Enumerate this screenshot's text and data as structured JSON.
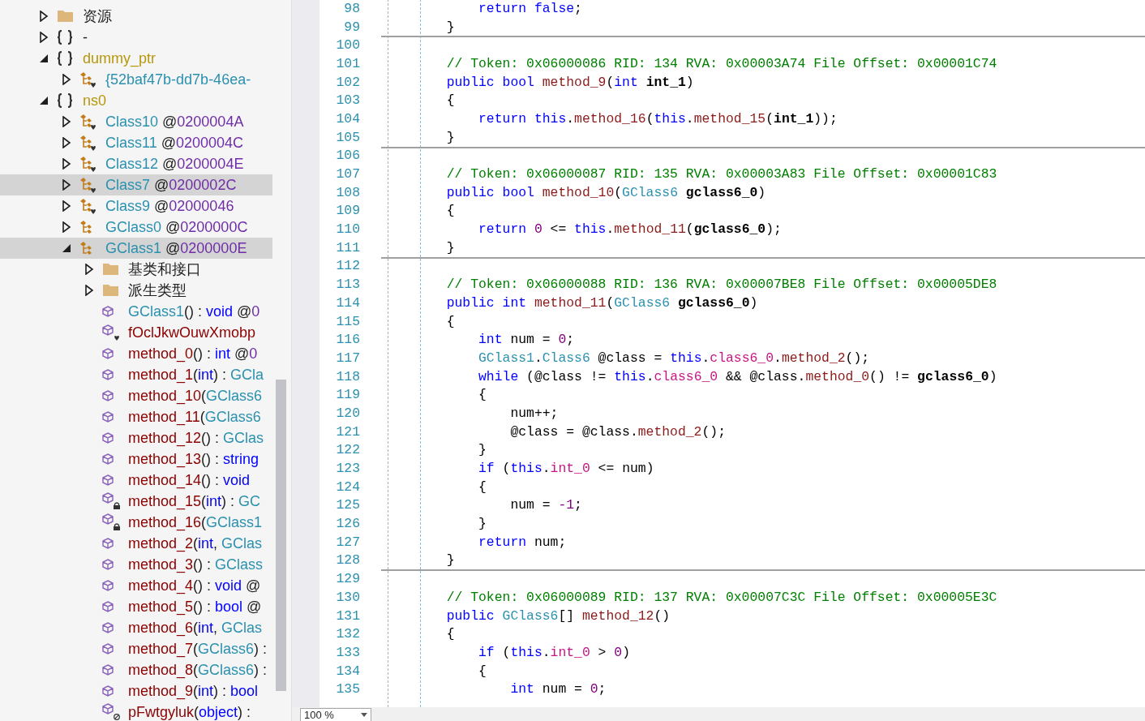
{
  "tree": {
    "items": [
      {
        "kind": "folder",
        "selected": false,
        "expanded": false,
        "label": [
          {
            "t": "资源",
            "kind": "plain"
          }
        ]
      },
      {
        "kind": "namespace",
        "selected": false,
        "expanded": false,
        "label": [
          {
            "t": "-",
            "kind": "plain"
          }
        ]
      },
      {
        "kind": "namespace",
        "selected": false,
        "expanded": true,
        "label": [
          {
            "t": "dummy_ptr",
            "kind": "ns"
          }
        ],
        "children": [
          {
            "kind": "class",
            "selected": false,
            "expanded": false,
            "label": [
              {
                "t": "{52baf47b-dd7b-46ea-",
                "kind": "type"
              }
            ]
          }
        ]
      },
      {
        "kind": "namespace",
        "selected": false,
        "expanded": true,
        "label": [
          {
            "t": "ns0",
            "kind": "ns"
          }
        ],
        "children": [
          {
            "kind": "class",
            "selected": false,
            "expanded": false,
            "label": [
              {
                "t": "Class10",
                "kind": "type"
              },
              {
                "t": " @",
                "kind": "plain"
              },
              {
                "t": "0200004A",
                "kind": "addr"
              }
            ]
          },
          {
            "kind": "class",
            "selected": false,
            "expanded": false,
            "label": [
              {
                "t": "Class11",
                "kind": "type"
              },
              {
                "t": " @",
                "kind": "plain"
              },
              {
                "t": "0200004C",
                "kind": "addr"
              }
            ]
          },
          {
            "kind": "class",
            "selected": false,
            "expanded": false,
            "label": [
              {
                "t": "Class12",
                "kind": "type"
              },
              {
                "t": " @",
                "kind": "plain"
              },
              {
                "t": "0200004E",
                "kind": "addr"
              }
            ]
          },
          {
            "kind": "class",
            "selected": true,
            "expanded": false,
            "label": [
              {
                "t": "Class7",
                "kind": "type"
              },
              {
                "t": " @",
                "kind": "plain"
              },
              {
                "t": "0200002C",
                "kind": "addr"
              }
            ]
          },
          {
            "kind": "class",
            "selected": false,
            "expanded": false,
            "label": [
              {
                "t": "Class9",
                "kind": "type"
              },
              {
                "t": " @",
                "kind": "plain"
              },
              {
                "t": "02000046",
                "kind": "addr"
              }
            ]
          },
          {
            "kind": "gclass",
            "selected": false,
            "expanded": false,
            "label": [
              {
                "t": "GClass0",
                "kind": "type"
              },
              {
                "t": " @",
                "kind": "plain"
              },
              {
                "t": "0200000C",
                "kind": "addr"
              }
            ]
          },
          {
            "kind": "gclass",
            "selected": true,
            "expanded": true,
            "label": [
              {
                "t": "GClass1",
                "kind": "type"
              },
              {
                "t": " @",
                "kind": "plain"
              },
              {
                "t": "0200000E",
                "kind": "addr"
              }
            ],
            "children": [
              {
                "kind": "folder",
                "selected": false,
                "expanded": false,
                "label": [
                  {
                    "t": "基类和接口",
                    "kind": "plain"
                  }
                ]
              },
              {
                "kind": "folder",
                "selected": false,
                "expanded": false,
                "label": [
                  {
                    "t": "派生类型",
                    "kind": "plain"
                  }
                ]
              },
              {
                "kind": "method",
                "selected": false,
                "label": [
                  {
                    "t": "GClass1",
                    "kind": "type"
                  },
                  {
                    "t": "() : ",
                    "kind": "plain"
                  },
                  {
                    "t": "void",
                    "kind": "kw"
                  },
                  {
                    "t": " @",
                    "kind": "plain"
                  },
                  {
                    "t": "0",
                    "kind": "addr"
                  }
                ]
              },
              {
                "kind": "internalmethod",
                "selected": false,
                "label": [
                  {
                    "t": "fOclJkwOuwXmobp",
                    "kind": "method"
                  }
                ]
              },
              {
                "kind": "method",
                "selected": false,
                "label": [
                  {
                    "t": "method_0",
                    "kind": "method"
                  },
                  {
                    "t": "() : ",
                    "kind": "plain"
                  },
                  {
                    "t": "int",
                    "kind": "kw"
                  },
                  {
                    "t": " @",
                    "kind": "plain"
                  },
                  {
                    "t": "0",
                    "kind": "addr"
                  }
                ]
              },
              {
                "kind": "method",
                "selected": false,
                "label": [
                  {
                    "t": "method_1",
                    "kind": "method"
                  },
                  {
                    "t": "(",
                    "kind": "plain"
                  },
                  {
                    "t": "int",
                    "kind": "kw"
                  },
                  {
                    "t": ") : ",
                    "kind": "plain"
                  },
                  {
                    "t": "GCla",
                    "kind": "type"
                  }
                ]
              },
              {
                "kind": "method",
                "selected": false,
                "label": [
                  {
                    "t": "method_10",
                    "kind": "method"
                  },
                  {
                    "t": "(",
                    "kind": "plain"
                  },
                  {
                    "t": "GClass6",
                    "kind": "type"
                  }
                ]
              },
              {
                "kind": "method",
                "selected": false,
                "label": [
                  {
                    "t": "method_11",
                    "kind": "method"
                  },
                  {
                    "t": "(",
                    "kind": "plain"
                  },
                  {
                    "t": "GClass6",
                    "kind": "type"
                  }
                ]
              },
              {
                "kind": "method",
                "selected": false,
                "label": [
                  {
                    "t": "method_12",
                    "kind": "method"
                  },
                  {
                    "t": "() : ",
                    "kind": "plain"
                  },
                  {
                    "t": "GClas",
                    "kind": "type"
                  }
                ]
              },
              {
                "kind": "method",
                "selected": false,
                "label": [
                  {
                    "t": "method_13",
                    "kind": "method"
                  },
                  {
                    "t": "() : ",
                    "kind": "plain"
                  },
                  {
                    "t": "string",
                    "kind": "kw"
                  }
                ]
              },
              {
                "kind": "method",
                "selected": false,
                "label": [
                  {
                    "t": "method_14",
                    "kind": "method"
                  },
                  {
                    "t": "() : ",
                    "kind": "plain"
                  },
                  {
                    "t": "void",
                    "kind": "kw"
                  }
                ]
              },
              {
                "kind": "privatemethod",
                "selected": false,
                "label": [
                  {
                    "t": "method_15",
                    "kind": "method"
                  },
                  {
                    "t": "(",
                    "kind": "plain"
                  },
                  {
                    "t": "int",
                    "kind": "kw"
                  },
                  {
                    "t": ") : ",
                    "kind": "plain"
                  },
                  {
                    "t": "GC",
                    "kind": "type"
                  }
                ]
              },
              {
                "kind": "privatemethod",
                "selected": false,
                "label": [
                  {
                    "t": "method_16",
                    "kind": "method"
                  },
                  {
                    "t": "(",
                    "kind": "plain"
                  },
                  {
                    "t": "GClass1",
                    "kind": "type"
                  }
                ]
              },
              {
                "kind": "method",
                "selected": false,
                "label": [
                  {
                    "t": "method_2",
                    "kind": "method"
                  },
                  {
                    "t": "(",
                    "kind": "plain"
                  },
                  {
                    "t": "int",
                    "kind": "kw"
                  },
                  {
                    "t": ", ",
                    "kind": "plain"
                  },
                  {
                    "t": "GClas",
                    "kind": "type"
                  }
                ]
              },
              {
                "kind": "method",
                "selected": false,
                "label": [
                  {
                    "t": "method_3",
                    "kind": "method"
                  },
                  {
                    "t": "() : ",
                    "kind": "plain"
                  },
                  {
                    "t": "GClass",
                    "kind": "type"
                  }
                ]
              },
              {
                "kind": "method",
                "selected": false,
                "label": [
                  {
                    "t": "method_4",
                    "kind": "method"
                  },
                  {
                    "t": "() : ",
                    "kind": "plain"
                  },
                  {
                    "t": "void",
                    "kind": "kw"
                  },
                  {
                    "t": " @",
                    "kind": "plain"
                  }
                ]
              },
              {
                "kind": "method",
                "selected": false,
                "label": [
                  {
                    "t": "method_5",
                    "kind": "method"
                  },
                  {
                    "t": "() : ",
                    "kind": "plain"
                  },
                  {
                    "t": "bool",
                    "kind": "kw"
                  },
                  {
                    "t": " @",
                    "kind": "plain"
                  }
                ]
              },
              {
                "kind": "method",
                "selected": false,
                "label": [
                  {
                    "t": "method_6",
                    "kind": "method"
                  },
                  {
                    "t": "(",
                    "kind": "plain"
                  },
                  {
                    "t": "int",
                    "kind": "kw"
                  },
                  {
                    "t": ", ",
                    "kind": "plain"
                  },
                  {
                    "t": "GClas",
                    "kind": "type"
                  }
                ]
              },
              {
                "kind": "method",
                "selected": false,
                "label": [
                  {
                    "t": "method_7",
                    "kind": "method"
                  },
                  {
                    "t": "(",
                    "kind": "plain"
                  },
                  {
                    "t": "GClass6",
                    "kind": "type"
                  },
                  {
                    "t": ") :",
                    "kind": "plain"
                  }
                ]
              },
              {
                "kind": "method",
                "selected": false,
                "label": [
                  {
                    "t": "method_8",
                    "kind": "method"
                  },
                  {
                    "t": "(",
                    "kind": "plain"
                  },
                  {
                    "t": "GClass6",
                    "kind": "type"
                  },
                  {
                    "t": ") :",
                    "kind": "plain"
                  }
                ]
              },
              {
                "kind": "method",
                "selected": false,
                "label": [
                  {
                    "t": "method_9",
                    "kind": "method"
                  },
                  {
                    "t": "(",
                    "kind": "plain"
                  },
                  {
                    "t": "int",
                    "kind": "kw"
                  },
                  {
                    "t": ") : ",
                    "kind": "plain"
                  },
                  {
                    "t": "bool",
                    "kind": "kw"
                  }
                ]
              },
              {
                "kind": "blockedmethod",
                "selected": false,
                "label": [
                  {
                    "t": "pFwtgyluk",
                    "kind": "method"
                  },
                  {
                    "t": "(",
                    "kind": "plain"
                  },
                  {
                    "t": "object",
                    "kind": "kw"
                  },
                  {
                    "t": ") :",
                    "kind": "plain"
                  }
                ]
              }
            ]
          }
        ]
      }
    ]
  },
  "editor": {
    "lines": [
      {
        "children": [
          {
            "number": "98",
            "code": [
              {
                "t": "return ",
                "kind": "kw"
              },
              {
                "t": "false",
                "kind": "kw"
              },
              {
                "t": ";",
                "kind": "plain"
              }
            ]
          }
        ]
      },
      {
        "number": "99",
        "separator": true,
        "code": [
          {
            "t": "}",
            "kind": "plain"
          }
        ]
      },
      {
        "number": "100"
      },
      {
        "number": "101",
        "code": [
          {
            "t": "// Token: 0x06000086 RID: 134 RVA: 0x00003A74 File Offset: 0x00001C74",
            "kind": "comment"
          }
        ]
      },
      {
        "number": "102",
        "code": [
          {
            "t": "public ",
            "kind": "kw"
          },
          {
            "t": "bool ",
            "kind": "kw"
          },
          {
            "t": "method_9",
            "kind": "method"
          },
          {
            "t": "(",
            "kind": "plain"
          },
          {
            "t": "int ",
            "kind": "kw"
          },
          {
            "t": "int_1",
            "kind": "param"
          },
          {
            "t": ")",
            "kind": "plain"
          }
        ]
      },
      {
        "number": "103",
        "code": [
          {
            "t": "{",
            "kind": "plain"
          }
        ],
        "children": [
          {
            "number": "104",
            "code": [
              {
                "t": "return ",
                "kind": "kw"
              },
              {
                "t": "this",
                "kind": "kw"
              },
              {
                "t": ".",
                "kind": "plain"
              },
              {
                "t": "method_16",
                "kind": "method"
              },
              {
                "t": "(",
                "kind": "plain"
              },
              {
                "t": "this",
                "kind": "kw"
              },
              {
                "t": ".",
                "kind": "plain"
              },
              {
                "t": "method_15",
                "kind": "method"
              },
              {
                "t": "(",
                "kind": "plain"
              },
              {
                "t": "int_1",
                "kind": "param"
              },
              {
                "t": "));",
                "kind": "plain"
              }
            ]
          }
        ]
      },
      {
        "number": "105",
        "separator": true,
        "code": [
          {
            "t": "}",
            "kind": "plain"
          }
        ]
      },
      {
        "number": "106"
      },
      {
        "number": "107",
        "code": [
          {
            "t": "// Token: 0x06000087 RID: 135 RVA: 0x00003A83 File Offset: 0x00001C83",
            "kind": "comment"
          }
        ]
      },
      {
        "number": "108",
        "code": [
          {
            "t": "public ",
            "kind": "kw"
          },
          {
            "t": "bool ",
            "kind": "kw"
          },
          {
            "t": "method_10",
            "kind": "method"
          },
          {
            "t": "(",
            "kind": "plain"
          },
          {
            "t": "GClass6",
            "kind": "type"
          },
          {
            "t": " gclass6_0",
            "kind": "param"
          },
          {
            "t": ")",
            "kind": "plain"
          }
        ]
      },
      {
        "number": "109",
        "code": [
          {
            "t": "{",
            "kind": "plain"
          }
        ],
        "children": [
          {
            "number": "110",
            "code": [
              {
                "t": "return ",
                "kind": "kw"
              },
              {
                "t": "0",
                "kind": "num"
              },
              {
                "t": " <= ",
                "kind": "plain"
              },
              {
                "t": "this",
                "kind": "kw"
              },
              {
                "t": ".",
                "kind": "plain"
              },
              {
                "t": "method_11",
                "kind": "method"
              },
              {
                "t": "(",
                "kind": "plain"
              },
              {
                "t": "gclass6_0",
                "kind": "param"
              },
              {
                "t": ");",
                "kind": "plain"
              }
            ]
          }
        ]
      },
      {
        "number": "111",
        "separator": true,
        "code": [
          {
            "t": "}",
            "kind": "plain"
          }
        ]
      },
      {
        "number": "112"
      },
      {
        "number": "113",
        "code": [
          {
            "t": "// Token: 0x06000088 RID: 136 RVA: 0x00007BE8 File Offset: 0x00005DE8",
            "kind": "comment"
          }
        ]
      },
      {
        "number": "114",
        "code": [
          {
            "t": "public ",
            "kind": "kw"
          },
          {
            "t": "int ",
            "kind": "kw"
          },
          {
            "t": "method_11",
            "kind": "method"
          },
          {
            "t": "(",
            "kind": "plain"
          },
          {
            "t": "GClass6",
            "kind": "type"
          },
          {
            "t": " gclass6_0",
            "kind": "param"
          },
          {
            "t": ")",
            "kind": "plain"
          }
        ]
      },
      {
        "number": "115",
        "code": [
          {
            "t": "{",
            "kind": "plain"
          }
        ],
        "children": [
          {
            "number": "116",
            "code": [
              {
                "t": "int ",
                "kind": "kw"
              },
              {
                "t": "num = ",
                "kind": "plain"
              },
              {
                "t": "0",
                "kind": "num"
              },
              {
                "t": ";",
                "kind": "plain"
              }
            ]
          },
          {
            "number": "117",
            "code": [
              {
                "t": "GClass1",
                "kind": "type"
              },
              {
                "t": ".",
                "kind": "plain"
              },
              {
                "t": "Class6",
                "kind": "type"
              },
              {
                "t": " @class = ",
                "kind": "plain"
              },
              {
                "t": "this",
                "kind": "kw"
              },
              {
                "t": ".",
                "kind": "plain"
              },
              {
                "t": "class6_0",
                "kind": "field"
              },
              {
                "t": ".",
                "kind": "plain"
              },
              {
                "t": "method_2",
                "kind": "method"
              },
              {
                "t": "();",
                "kind": "plain"
              }
            ]
          },
          {
            "number": "118",
            "code": [
              {
                "t": "while ",
                "kind": "kw"
              },
              {
                "t": "(@class != ",
                "kind": "plain"
              },
              {
                "t": "this",
                "kind": "kw"
              },
              {
                "t": ".",
                "kind": "plain"
              },
              {
                "t": "class6_0",
                "kind": "field"
              },
              {
                "t": " && @class.",
                "kind": "plain"
              },
              {
                "t": "method_0",
                "kind": "method"
              },
              {
                "t": "() != ",
                "kind": "plain"
              },
              {
                "t": "gclass6_0",
                "kind": "param"
              },
              {
                "t": ")",
                "kind": "plain"
              }
            ]
          },
          {
            "number": "119",
            "code": [
              {
                "t": "{",
                "kind": "plain"
              }
            ],
            "children": [
              {
                "number": "120",
                "code": [
                  {
                    "t": "num++;",
                    "kind": "plain"
                  }
                ]
              },
              {
                "number": "121",
                "code": [
                  {
                    "t": "@class = @class.",
                    "kind": "plain"
                  },
                  {
                    "t": "method_2",
                    "kind": "method"
                  },
                  {
                    "t": "();",
                    "kind": "plain"
                  }
                ]
              }
            ]
          },
          {
            "number": "122",
            "code": [
              {
                "t": "}",
                "kind": "plain"
              }
            ]
          },
          {
            "number": "123",
            "code": [
              {
                "t": "if ",
                "kind": "kw"
              },
              {
                "t": "(",
                "kind": "plain"
              },
              {
                "t": "this",
                "kind": "kw"
              },
              {
                "t": ".",
                "kind": "plain"
              },
              {
                "t": "int_0",
                "kind": "field"
              },
              {
                "t": " <= num)",
                "kind": "plain"
              }
            ]
          },
          {
            "number": "124",
            "code": [
              {
                "t": "{",
                "kind": "plain"
              }
            ],
            "children": [
              {
                "number": "125",
                "code": [
                  {
                    "t": "num = ",
                    "kind": "plain"
                  },
                  {
                    "t": "-1",
                    "kind": "num"
                  },
                  {
                    "t": ";",
                    "kind": "plain"
                  }
                ]
              }
            ]
          },
          {
            "number": "126",
            "code": [
              {
                "t": "}",
                "kind": "plain"
              }
            ]
          },
          {
            "number": "127",
            "code": [
              {
                "t": "return ",
                "kind": "kw"
              },
              {
                "t": "num;",
                "kind": "plain"
              }
            ]
          }
        ]
      },
      {
        "number": "128",
        "separator": true,
        "code": [
          {
            "t": "}",
            "kind": "plain"
          }
        ]
      },
      {
        "number": "129"
      },
      {
        "number": "130",
        "code": [
          {
            "t": "// Token: 0x06000089 RID: 137 RVA: 0x00007C3C File Offset: 0x00005E3C",
            "kind": "comment"
          }
        ]
      },
      {
        "number": "131",
        "code": [
          {
            "t": "public ",
            "kind": "kw"
          },
          {
            "t": "GClass6",
            "kind": "type"
          },
          {
            "t": "[] ",
            "kind": "plain"
          },
          {
            "t": "method_12",
            "kind": "method"
          },
          {
            "t": "()",
            "kind": "plain"
          }
        ]
      },
      {
        "number": "132",
        "code": [
          {
            "t": "{",
            "kind": "plain"
          }
        ],
        "children": [
          {
            "number": "133",
            "code": [
              {
                "t": "if ",
                "kind": "kw"
              },
              {
                "t": "(",
                "kind": "plain"
              },
              {
                "t": "this",
                "kind": "kw"
              },
              {
                "t": ".",
                "kind": "plain"
              },
              {
                "t": "int_0",
                "kind": "field"
              },
              {
                "t": " > ",
                "kind": "plain"
              },
              {
                "t": "0",
                "kind": "num"
              },
              {
                "t": ")",
                "kind": "plain"
              }
            ]
          },
          {
            "number": "134",
            "code": [
              {
                "t": "{",
                "kind": "plain"
              }
            ],
            "children": [
              {
                "number": "135",
                "code": [
                  {
                    "t": "int ",
                    "kind": "kw"
                  },
                  {
                    "t": "num = ",
                    "kind": "plain"
                  },
                  {
                    "t": "0",
                    "kind": "num"
                  },
                  {
                    "t": ";",
                    "kind": "plain"
                  }
                ]
              }
            ]
          }
        ]
      }
    ]
  },
  "zoom_select": {
    "value": "100 %"
  }
}
